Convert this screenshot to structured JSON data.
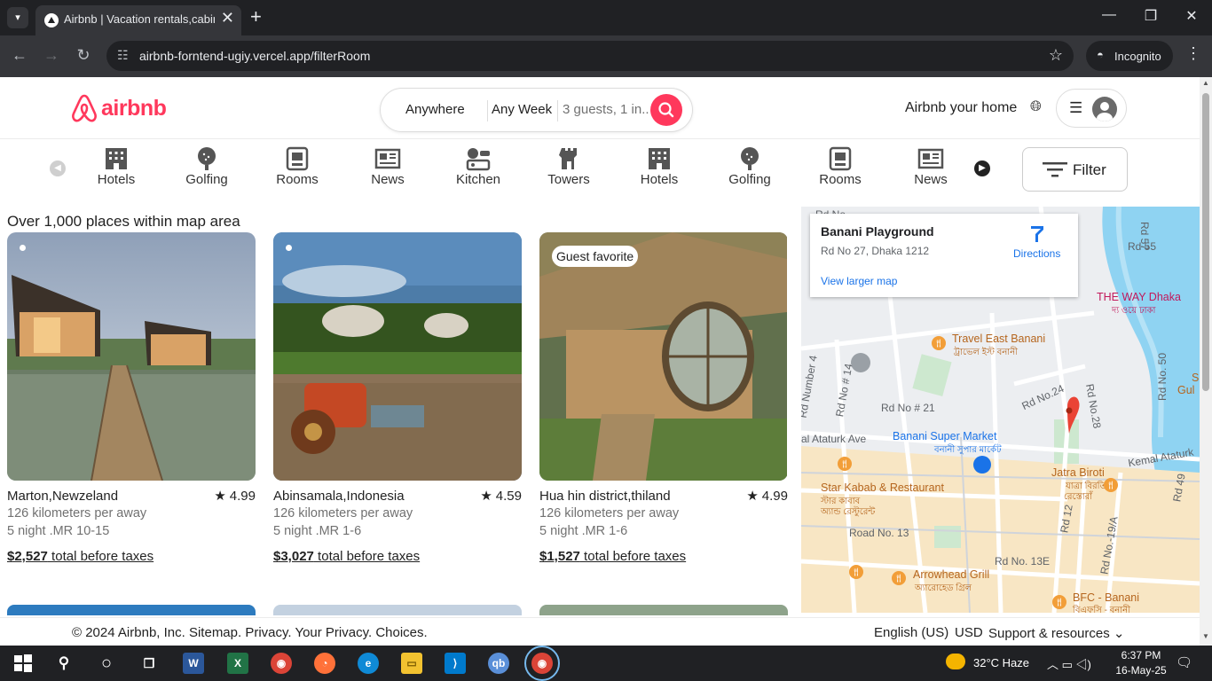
{
  "browser": {
    "tab_title": "Airbnb | Vacation rentals,cabin",
    "url": "airbnb-forntend-ugiy.vercel.app/filterRoom",
    "incognito_label": "Incognito",
    "new_tab": "+",
    "close_tab": "✕",
    "win_min": "—",
    "win_max": "❐",
    "win_close": "✕"
  },
  "header": {
    "logo": "airbnb",
    "search": {
      "anywhere": "Anywhere",
      "week": "Any Week",
      "guests": "3 guests, 1 in.."
    },
    "host_link": "Airbnb your home"
  },
  "categories": [
    {
      "label": "Hotels",
      "icon": "hotel-icon"
    },
    {
      "label": "Golfing",
      "icon": "golf-icon"
    },
    {
      "label": "Rooms",
      "icon": "room-icon"
    },
    {
      "label": "News",
      "icon": "news-icon"
    },
    {
      "label": "Kitchen",
      "icon": "kitchen-icon"
    },
    {
      "label": "Towers",
      "icon": "tower-icon"
    },
    {
      "label": "Hotels",
      "icon": "hotel-icon"
    },
    {
      "label": "Golfing",
      "icon": "golf-icon"
    },
    {
      "label": "Rooms",
      "icon": "room-icon"
    },
    {
      "label": "News",
      "icon": "news-icon"
    }
  ],
  "filter_label": "Filter",
  "results_title": "Over 1,000 places within map area",
  "listings": [
    {
      "title": "Marton,Newzeland",
      "rating": "4.99",
      "distance": "126 kilometers per away",
      "nights": "5 night .MR 10-15",
      "price": "$2,527",
      "price_suffix": " total before taxes",
      "badge": ""
    },
    {
      "title": "Abinsamala,Indonesia",
      "rating": "4.59",
      "distance": "126 kilometers per away",
      "nights": "5 night .MR 1-6",
      "price": "$3,027",
      "price_suffix": " total before taxes",
      "badge": ""
    },
    {
      "title": "Hua hin district,thiland",
      "rating": "4.99",
      "distance": "126 kilometers per away",
      "nights": "5 night .MR 1-6",
      "price": "$1,527",
      "price_suffix": " total before taxes",
      "badge": "Guest favorite"
    }
  ],
  "map": {
    "place_title": "Banani Playground",
    "place_address": "Rd No 27, Dhaka 1212",
    "directions": "Directions",
    "view_larger": "View larger map",
    "roads": [
      "Rd No",
      "Rd 57",
      "Rd 55",
      "Rd No. 50",
      "Rd Number 4",
      "Rd No # 14",
      "Rd No # 21",
      "Rd No.24",
      "Rd No.28",
      "al Ataturk Ave",
      "Kemal Ataturk",
      "Rd 49",
      "Road No. 13",
      "Rd No. 13E",
      "Rd 12",
      "Rd No.-19/A"
    ],
    "pois": [
      "THE WAY Dhaka",
      "দ্য ওয়ে ঢাকা",
      "Travel East Banani",
      "ট্রাভেল ইস্ট বনানী",
      "Banani Super Market",
      "বনানী সুপার মার্কেট",
      "Star Kabab & Restaurant",
      "স্টার কাবাব",
      "অ্যান্ড রেস্টুরেন্ট",
      "Jatra Biroti",
      "যাত্রা বিরতি",
      "রেস্তোরাঁ",
      "Arrowhead Grill",
      "অ্যারোহেড গ্রিল",
      "BFC - Banani",
      "বিএফসি - বনানী",
      "S",
      "Gul"
    ]
  },
  "footer": {
    "copyright": "© 2024 Airbnb, Inc.  Sitemap.  Privacy.  Your Privacy.  Choices.",
    "language": "English (US)",
    "currency": "USD",
    "support": "Support & resources"
  },
  "taskbar": {
    "weather": "32°C  Haze",
    "time": "6:37 PM",
    "date": "16-May-25"
  },
  "colors": {
    "brand": "#ff385c",
    "map_pin": "#ea4335",
    "map_link": "#1a73e8"
  }
}
